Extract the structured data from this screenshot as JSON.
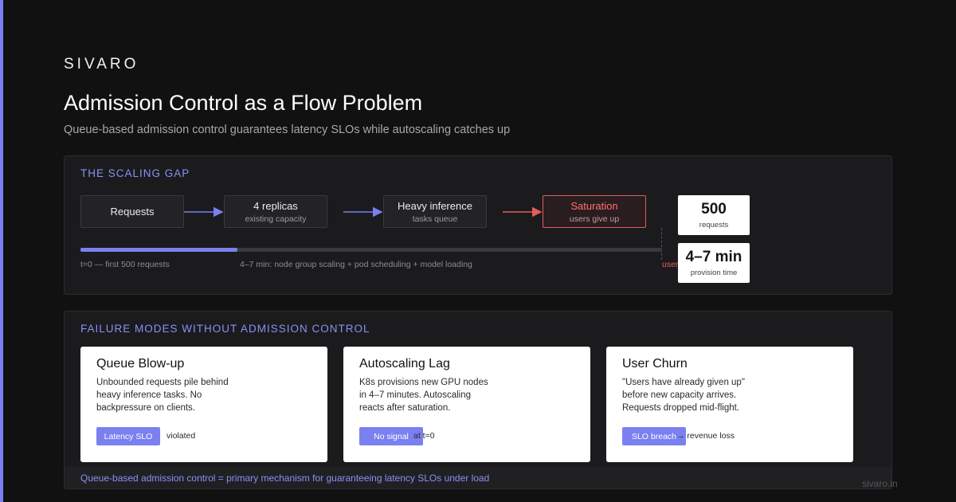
{
  "brand": "SIVARO",
  "title": "Admission Control as a Flow Problem",
  "subtitle": "Queue-based admission control guarantees latency SLOs while autoscaling catches up",
  "scaling_gap": {
    "heading": "THE SCALING GAP",
    "flow": [
      {
        "main": "Requests",
        "sub": ""
      },
      {
        "main": "4 replicas",
        "sub": "existing capacity"
      },
      {
        "main": "Heavy inference",
        "sub": "tasks queue"
      },
      {
        "main": "Saturation",
        "sub": "users give up"
      }
    ],
    "progress": 0.27,
    "timeline_labels": {
      "start": "t=0 — first 500 requests",
      "middle": "4–7 min: node group scaling + pod scheduling + model loading",
      "end": "user"
    },
    "stats": [
      {
        "value": "500",
        "label": "requests"
      },
      {
        "value": "4–7 min",
        "label": "provision time"
      }
    ]
  },
  "failure_modes": {
    "heading": "FAILURE MODES WITHOUT ADMISSION CONTROL",
    "cards": [
      {
        "title": "Queue Blow-up",
        "body": [
          "Unbounded requests pile behind",
          "heavy inference tasks. No",
          "backpressure on clients."
        ],
        "badge": "Latency SLO",
        "note": "violated"
      },
      {
        "title": "Autoscaling Lag",
        "body": [
          "K8s provisions new GPU nodes",
          "in 4–7 minutes. Autoscaling",
          "reacts after saturation."
        ],
        "badge": "No signal",
        "note": "at t=0"
      },
      {
        "title": "User Churn",
        "body": [
          "\"Users have already given up\"",
          "before new capacity arrives.",
          "Requests dropped mid-flight."
        ],
        "badge": "SLO breach",
        "note": "→ revenue loss"
      }
    ],
    "footer": "Queue-based admission control = primary mechanism for guaranteeing latency SLOs under load"
  },
  "site": "sivaro.in",
  "colors": {
    "accent": "#7b80f0",
    "danger": "#e35d5d",
    "background": "#111112"
  }
}
